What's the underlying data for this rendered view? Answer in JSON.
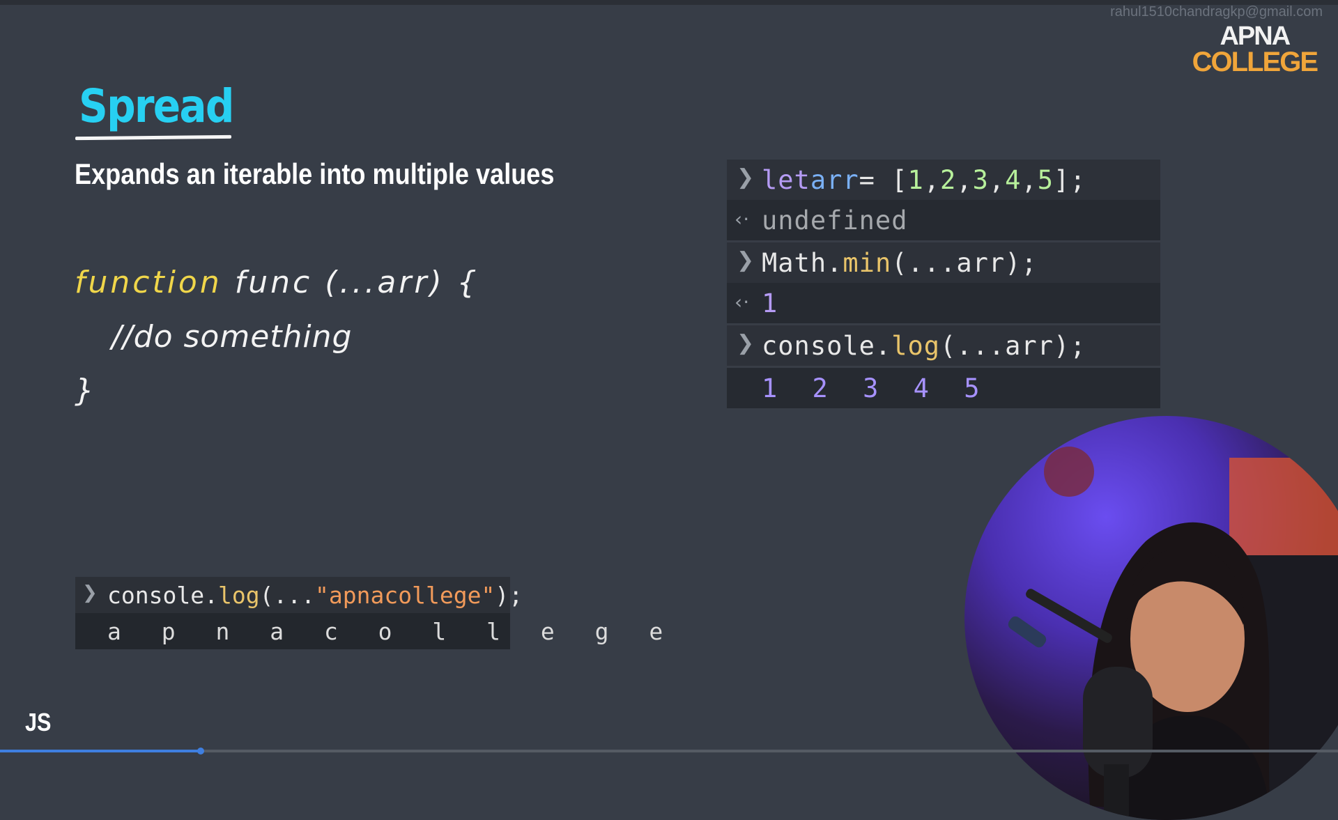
{
  "header": {
    "email": "rahul1510chandragkp@gmail.com",
    "logo_line1": "APNA",
    "logo_line2": "COLLEGE"
  },
  "slide": {
    "title": "Spread",
    "subtitle": "Expands an iterable into multiple values",
    "code": {
      "keyword": "function",
      "signature": "func (...arr) {",
      "body": "//do something",
      "close": "}"
    }
  },
  "console_right": {
    "rows": [
      {
        "type": "input",
        "parts": [
          "let",
          " arr",
          " = [",
          "1",
          ", ",
          "2",
          ", ",
          "3",
          ", ",
          "4",
          ", ",
          "5",
          "];"
        ]
      },
      {
        "type": "result",
        "text": "undefined"
      },
      {
        "type": "input",
        "parts": [
          "Math.",
          "min",
          "(...arr);"
        ]
      },
      {
        "type": "result",
        "text": "1"
      },
      {
        "type": "input",
        "parts": [
          "console.",
          "log",
          "(...arr);"
        ]
      },
      {
        "type": "output",
        "text": "1 2 3 4 5"
      }
    ]
  },
  "console_left": {
    "input_parts": [
      "console.",
      "log",
      "(...",
      "\"apnacollege\"",
      ");"
    ],
    "output": "a p n a c o l l e g e"
  },
  "footer": {
    "label": "JS",
    "progress": 0.15
  },
  "colors": {
    "background": "#373d47",
    "title": "#27d0f2",
    "keyword": "#f0d64a",
    "logo_accent": "#f0a53a",
    "progress": "#3f7fe0"
  },
  "icons": {
    "prompt": "chevron-right-icon",
    "result": "return-arrow-icon"
  }
}
